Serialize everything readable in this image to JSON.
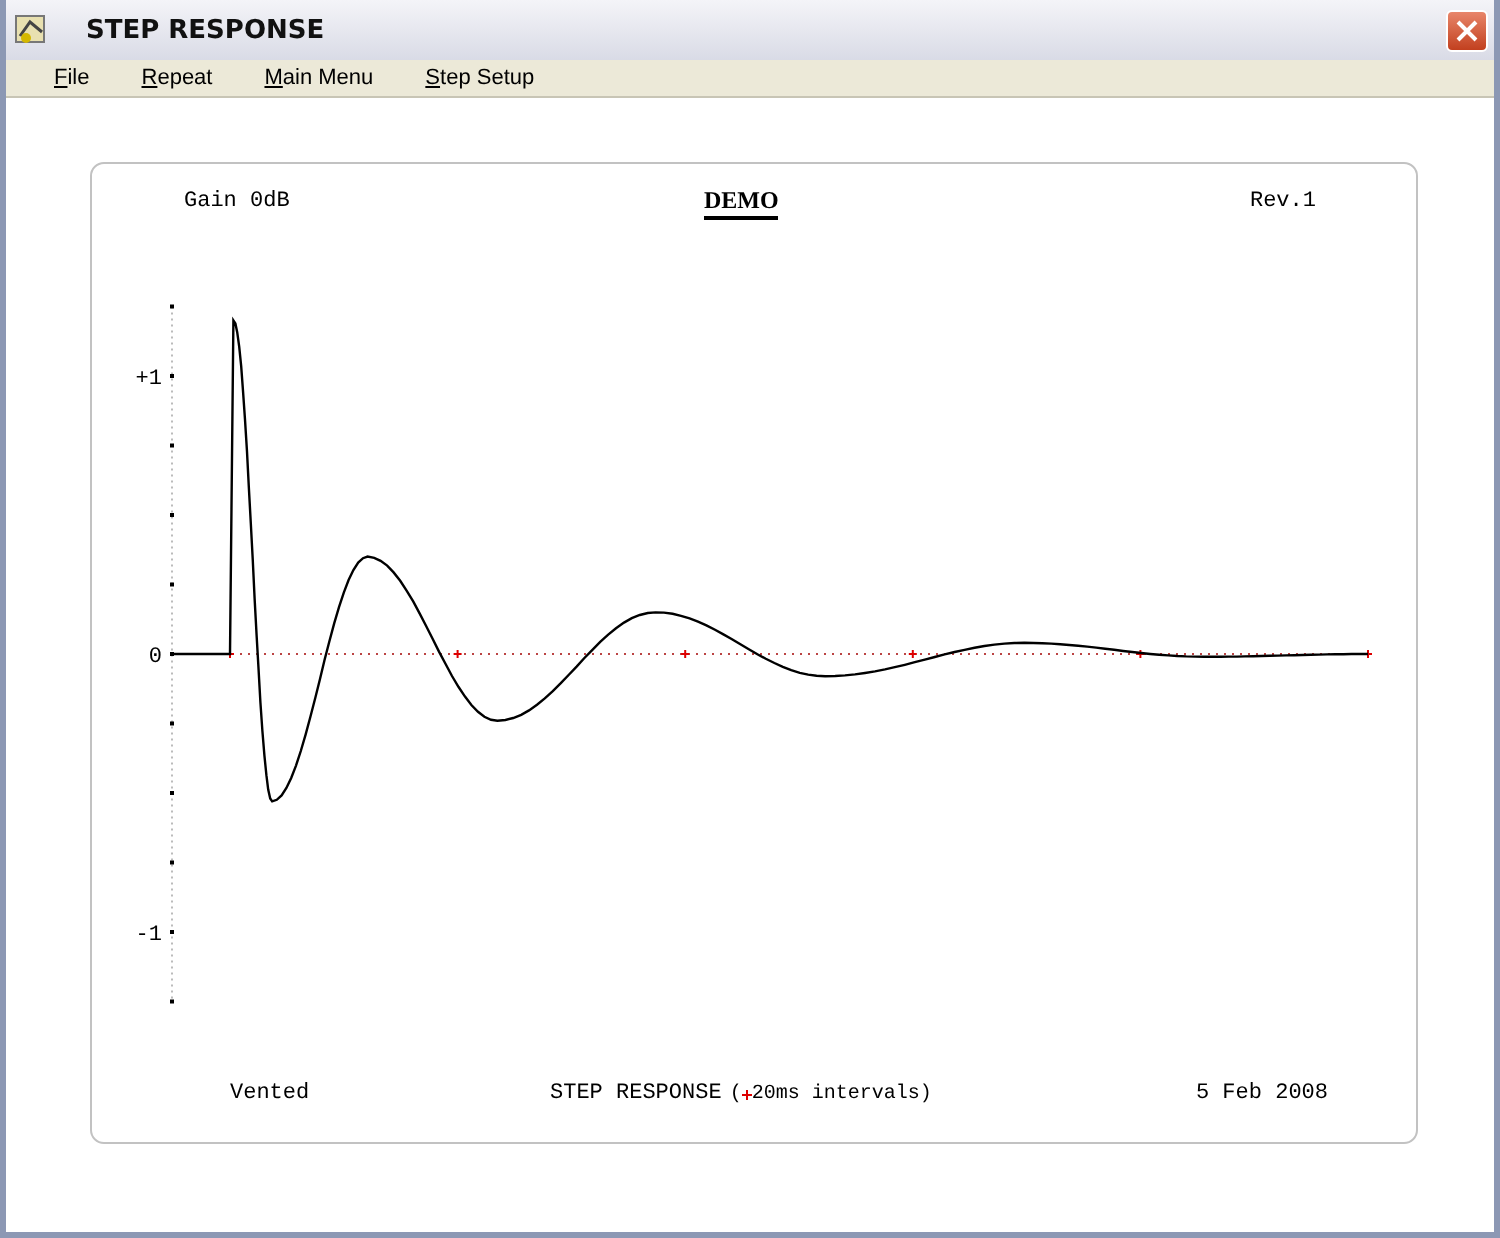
{
  "window": {
    "title": "STEP RESPONSE"
  },
  "menu": [
    {
      "label": "File"
    },
    {
      "label": "Repeat"
    },
    {
      "label": "Main Menu"
    },
    {
      "label": "Step Setup"
    }
  ],
  "header": {
    "left": "Gain 0dB",
    "center": "DEMO",
    "right": "Rev.1"
  },
  "plot": {
    "y_labels": [
      "+1",
      "0",
      "-1"
    ]
  },
  "footer": {
    "left": "Vented",
    "title": "STEP RESPONSE",
    "note_open": "(",
    "note": "20ms intervals)",
    "right": "5 Feb 2008"
  }
}
